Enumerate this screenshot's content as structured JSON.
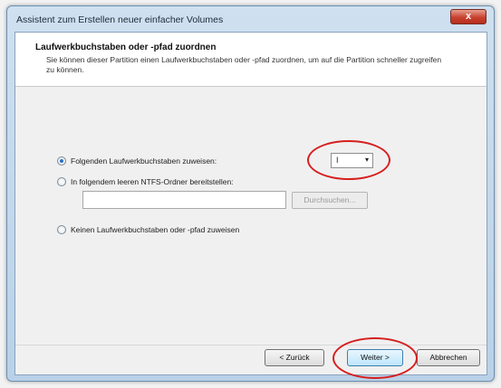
{
  "window": {
    "title": "Assistent zum Erstellen neuer einfacher Volumes",
    "close_glyph": "x"
  },
  "header": {
    "title": "Laufwerkbuchstaben oder -pfad zuordnen",
    "subtitle": "Sie können dieser Partition einen Laufwerkbuchstaben oder -pfad zuordnen, um auf die Partition schneller zugreifen zu können."
  },
  "options": {
    "assign_letter": {
      "label": "Folgenden Laufwerkbuchstaben zuweisen:",
      "checked": true
    },
    "mount_folder": {
      "label": "In folgendem leeren NTFS-Ordner bereitstellen:",
      "checked": false
    },
    "no_letter": {
      "label": "Keinen Laufwerkbuchstaben oder -pfad zuweisen",
      "checked": false
    }
  },
  "drive_select": {
    "value": "I",
    "arrow": "▾"
  },
  "folder_field": {
    "value": "",
    "browse_label": "Durchsuchen..."
  },
  "buttons": {
    "back": "< Zurück",
    "next": "Weiter >",
    "cancel": "Abbrechen"
  },
  "colors": {
    "highlight_ring": "#d61f1f",
    "radio_selected": "#2a6fc9"
  }
}
